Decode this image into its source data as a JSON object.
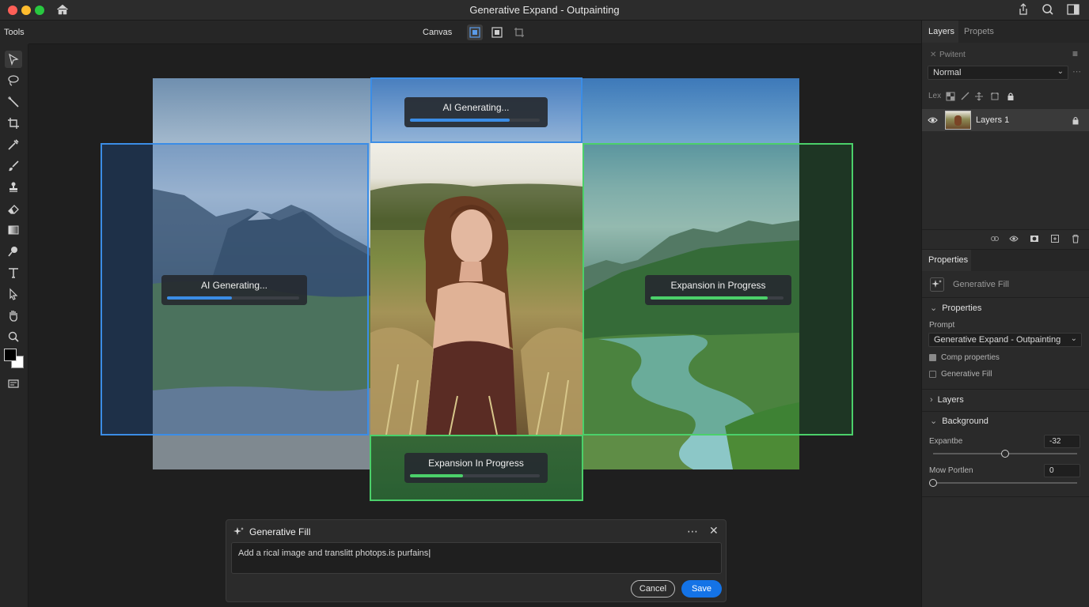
{
  "window": {
    "title": "Generative Expand - Outpainting"
  },
  "toolbar": {
    "label": "Tools",
    "fg_color": "#000000",
    "bg_color": "#ffffff"
  },
  "options_bar": {
    "canvas_label": "Canvas"
  },
  "canvas": {
    "badges": {
      "top": {
        "label": "AI Generating...",
        "progress": 0.77,
        "color": "#3b8de6"
      },
      "left": {
        "label": "AI Generating...",
        "progress": 0.49,
        "color": "#3b8de6"
      },
      "right": {
        "label": "Expansion in Progress",
        "progress": 0.88,
        "color": "#4bd06a"
      },
      "bottom": {
        "label": "Expansion In Progress",
        "progress": 0.41,
        "color": "#4bd06a"
      }
    }
  },
  "gen_fill_dialog": {
    "title": "Generative Fill",
    "prompt_value": "Add a rical image and translitt photops.is purfains",
    "cancel_label": "Cancel",
    "save_label": "Save"
  },
  "layers_panel": {
    "tabs": [
      "Layers",
      "Propets"
    ],
    "filter_label": "Pwitent",
    "blend_mode": "Normal",
    "lock_label": "Lex",
    "layer_name": "Layers 1"
  },
  "properties_panel": {
    "tab_label": "Properties",
    "item_label": "Generative Fill",
    "section_properties": "Properties",
    "prompt_label": "Prompt",
    "prompt_select": "Generative Expand - Outpainting",
    "checkbox_1": {
      "label": "Comp properties",
      "checked": true
    },
    "checkbox_2": {
      "label": "Generative Fill",
      "checked": false
    },
    "section_layers": "Layers",
    "section_background": "Background",
    "expand_label": "Expantbe",
    "expand_value": "-32",
    "expand_level": 0.5,
    "mow_label": "Mow Portlen",
    "mow_value": "0",
    "mow_level": 0.0
  }
}
